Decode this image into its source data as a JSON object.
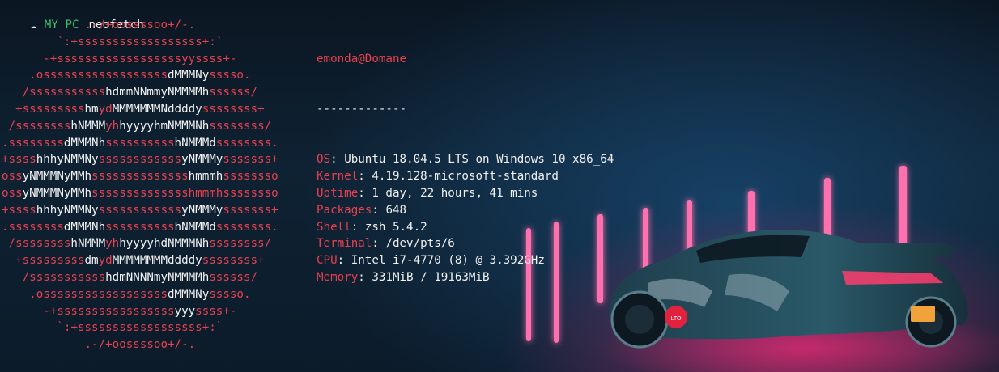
{
  "prompt": {
    "icon": "apple-icon",
    "host": "MY PC",
    "command": "neofetch"
  },
  "logo": [
    [
      [
        "r",
        "            .-/+oossssoo+/-."
      ]
    ],
    [
      [
        "r",
        "        `:+ssssssssssssssssss+:`"
      ]
    ],
    [
      [
        "r",
        "      -+ssssssssssssssssssyyssss+-"
      ]
    ],
    [
      [
        "r",
        "    .ossssssssssssssssss"
      ],
      [
        "w",
        "dMMMNy"
      ],
      [
        "r",
        "sssso."
      ]
    ],
    [
      [
        "r",
        "   /sssssssssss"
      ],
      [
        "w",
        "hdmmNNmmyNMMMMh"
      ],
      [
        "r",
        "ssssss/"
      ]
    ],
    [
      [
        "r",
        "  +sssssssss"
      ],
      [
        "w",
        "hm"
      ],
      [
        "r",
        "yd"
      ],
      [
        "w",
        "MMMMMMMNddddy"
      ],
      [
        "r",
        "ssssssss+"
      ]
    ],
    [
      [
        "r",
        " /ssssssss"
      ],
      [
        "w",
        "hNMMM"
      ],
      [
        "r",
        "yh"
      ],
      [
        "w",
        "hyyyyhmNMMMNh"
      ],
      [
        "r",
        "ssssssss/"
      ]
    ],
    [
      [
        "r",
        ".ssssssss"
      ],
      [
        "w",
        "dMMMNh"
      ],
      [
        "r",
        "ssssssssss"
      ],
      [
        "w",
        "hNMMMd"
      ],
      [
        "r",
        "ssssssss."
      ]
    ],
    [
      [
        "r",
        "+ssss"
      ],
      [
        "w",
        "hhhyNMMNy"
      ],
      [
        "r",
        "ssssssssssss"
      ],
      [
        "w",
        "yNMMMy"
      ],
      [
        "r",
        "sssssss+"
      ]
    ],
    [
      [
        "r",
        "oss"
      ],
      [
        "w",
        "yNMMMNyMMh"
      ],
      [
        "r",
        "ssssssssssssss"
      ],
      [
        "w",
        "hmmmh"
      ],
      [
        "r",
        "ssssssso"
      ]
    ],
    [
      [
        "r",
        "oss"
      ],
      [
        "w",
        "yNMMMNyMMh"
      ],
      [
        "r",
        "sssssssssssssshmmmhssssssso"
      ]
    ],
    [
      [
        "r",
        "+ssss"
      ],
      [
        "w",
        "hhhyNMMNy"
      ],
      [
        "r",
        "ssssssssssss"
      ],
      [
        "w",
        "yNMMMy"
      ],
      [
        "r",
        "sssssss+"
      ]
    ],
    [
      [
        "r",
        ".ssssssss"
      ],
      [
        "w",
        "dMMMNh"
      ],
      [
        "r",
        "ssssssssss"
      ],
      [
        "w",
        "hNMMMd"
      ],
      [
        "r",
        "ssssssss."
      ]
    ],
    [
      [
        "r",
        " /ssssssss"
      ],
      [
        "w",
        "hNMMM"
      ],
      [
        "r",
        "yh"
      ],
      [
        "w",
        "hyyyyhdNMMMNh"
      ],
      [
        "r",
        "ssssssss/"
      ]
    ],
    [
      [
        "r",
        "  +sssssssss"
      ],
      [
        "w",
        "dm"
      ],
      [
        "r",
        "yd"
      ],
      [
        "w",
        "MMMMMMMMddddy"
      ],
      [
        "r",
        "ssssssss+"
      ]
    ],
    [
      [
        "r",
        "   /sssssssssss"
      ],
      [
        "w",
        "hdmNNNNmyNMMMMh"
      ],
      [
        "r",
        "ssssss/"
      ]
    ],
    [
      [
        "r",
        "    .ossssssssssssssssss"
      ],
      [
        "w",
        "dMMMNy"
      ],
      [
        "r",
        "sssso."
      ]
    ],
    [
      [
        "r",
        "      -+sssssssssssssssss"
      ],
      [
        "w",
        "yyy"
      ],
      [
        "r",
        "ssss+-"
      ]
    ],
    [
      [
        "r",
        "        `:+ssssssssssssssssss+:`"
      ]
    ],
    [
      [
        "r",
        "            .-/+oossssoo+/-."
      ]
    ]
  ],
  "info": {
    "user_host": "emonda@Domane",
    "separator": "-------------",
    "rows": [
      {
        "key": "OS",
        "colon": ": ",
        "value": "Ubuntu 18.04.5 LTS on Windows 10 x86_64"
      },
      {
        "key": "Kernel",
        "colon": ": ",
        "value": "4.19.128-microsoft-standard"
      },
      {
        "key": "Uptime",
        "colon": ": ",
        "value": "1 day, 22 hours, 41 mins"
      },
      {
        "key": "Packages",
        "colon": ": ",
        "value": "648"
      },
      {
        "key": "Shell",
        "colon": ": ",
        "value": "zsh 5.4.2"
      },
      {
        "key": "Terminal",
        "colon": ": ",
        "value": "/dev/pts/6"
      },
      {
        "key": "CPU",
        "colon": ": ",
        "value": "Intel i7-4770 (8) @ 3.392GHz"
      },
      {
        "key": "Memory",
        "colon": ": ",
        "value": "331MiB / 19163MiB"
      }
    ]
  },
  "wallpaper": {
    "plate_text": "LTO",
    "accent": "#ff3d8b",
    "glow": "#ff2a78",
    "sky": "#0e2233"
  }
}
